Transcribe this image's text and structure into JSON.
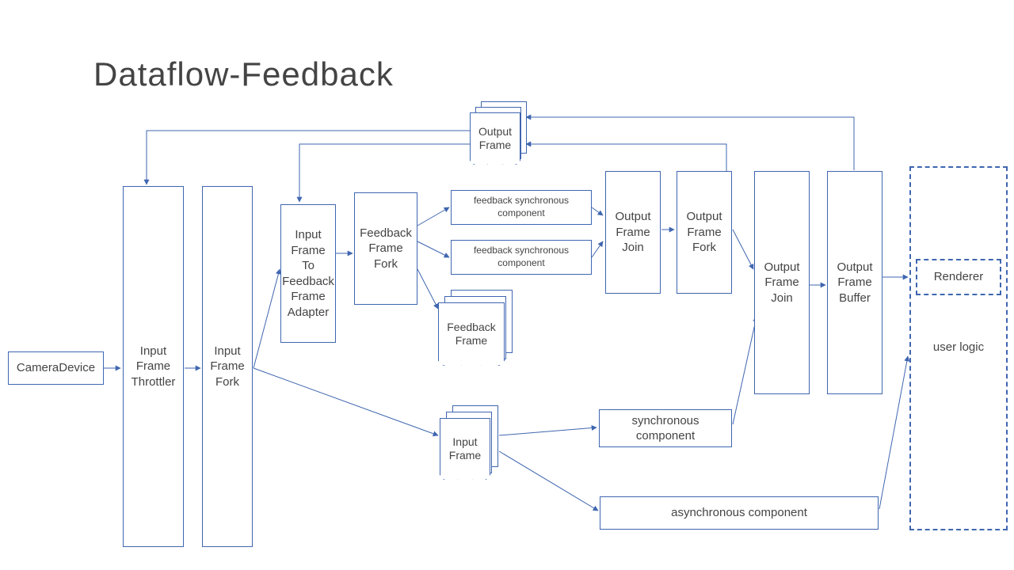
{
  "title": "Dataflow-Feedback",
  "nodes": {
    "camera": "CameraDevice",
    "throttler": "Input\nFrame\nThrottler",
    "ifork": "Input\nFrame\nFork",
    "adapter": "Input\nFrame\nTo\nFeedback\nFrame\nAdapter",
    "fbfork": "Feedback\nFrame\nFork",
    "fb_sync_1": "feedback synchronous\ncomponent",
    "fb_sync_2": "feedback synchronous\ncomponent",
    "ofjoin1": "Output\nFrame\nJoin",
    "offork": "Output\nFrame\nFork",
    "ofjoin2": "Output\nFrame\nJoin",
    "ofbuffer": "Output\nFrame\nBuffer",
    "sync_comp": "synchronous\ncomponent",
    "async_comp": "asynchronous component",
    "renderer": "Renderer",
    "user_logic": "user logic"
  },
  "docs": {
    "output_frame": "Output\nFrame",
    "feedback_frame": "Feedback\nFrame",
    "input_frame": "Input\nFrame"
  }
}
